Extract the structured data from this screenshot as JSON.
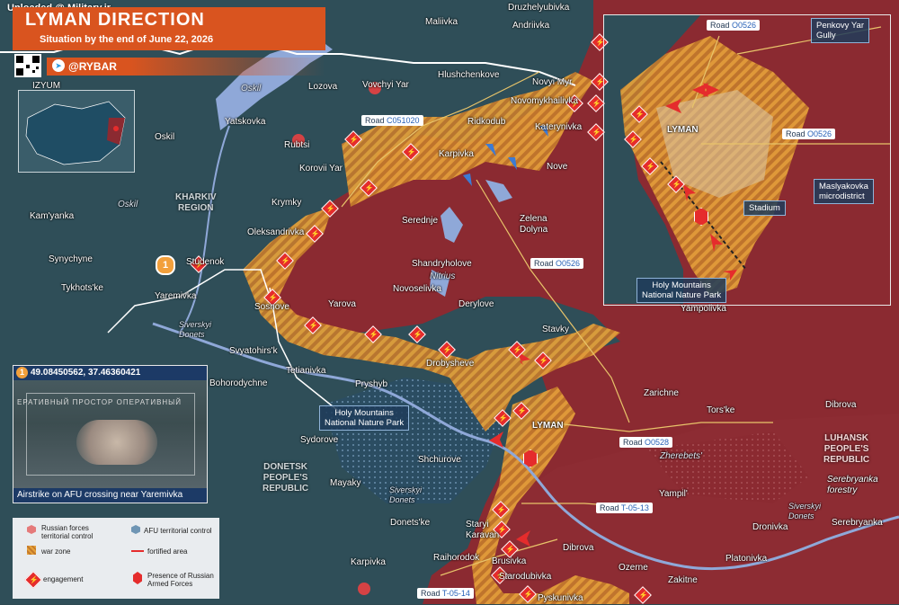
{
  "header": {
    "watermark": "Uploaded @ Military.ir",
    "title": "LYMAN DIRECTION",
    "subtitle": "Situation by the end of June 22, 2026",
    "brand": "@RYBAR"
  },
  "regions": {
    "kharkiv": "KHARKIV\nREGION",
    "donetsk": "DONETSK\nPEOPLE'S\nREPUBLIC",
    "luhansk": "LUHANSK\nPEOPLE'S\nREPUBLIC"
  },
  "places": [
    {
      "name": "Maliivka"
    },
    {
      "name": "Druzhelyubivka"
    },
    {
      "name": "Andriivka"
    },
    {
      "name": "Hlushchenkove"
    },
    {
      "name": "Lozova"
    },
    {
      "name": "Vovchyi Yar"
    },
    {
      "name": "Novyi Myr"
    },
    {
      "name": "Novomykhailivka"
    },
    {
      "name": "Ridkodub"
    },
    {
      "name": "Katerynivka"
    },
    {
      "name": "Yatskovka"
    },
    {
      "name": "Rubtsi"
    },
    {
      "name": "Oskil"
    },
    {
      "name": "Karpivka"
    },
    {
      "name": "Nove"
    },
    {
      "name": "Korovii Yar"
    },
    {
      "name": "Krymky"
    },
    {
      "name": "Serednje"
    },
    {
      "name": "Zelena\nDolyna"
    },
    {
      "name": "Kam'yanka"
    },
    {
      "name": "Oleksandrivka"
    },
    {
      "name": "Synychyne"
    },
    {
      "name": "Studenok"
    },
    {
      "name": "Shandryholove"
    },
    {
      "name": "Tykhots'ke"
    },
    {
      "name": "Yaremivka"
    },
    {
      "name": "Novoselivka"
    },
    {
      "name": "Derylove"
    },
    {
      "name": "Sosnove"
    },
    {
      "name": "Yarova"
    },
    {
      "name": "Yampolivka"
    },
    {
      "name": "Stavky"
    },
    {
      "name": "Svyatohirs'k"
    },
    {
      "name": "Drobysheve"
    },
    {
      "name": "Tetianivka"
    },
    {
      "name": "Pryshyb"
    },
    {
      "name": "Bohorodychne"
    },
    {
      "name": "Zarichne"
    },
    {
      "name": "Dibrova"
    },
    {
      "name": "LYMAN"
    },
    {
      "name": "Tors'ke"
    },
    {
      "name": "Sydorove"
    },
    {
      "name": "Shchurove"
    },
    {
      "name": "Mayaky"
    },
    {
      "name": "Yampil'"
    },
    {
      "name": "Donets'ke"
    },
    {
      "name": "Staryi\nKaravan"
    },
    {
      "name": "Dibrova"
    },
    {
      "name": "Dronivka"
    },
    {
      "name": "Serebryanka"
    },
    {
      "name": "Karpivka"
    },
    {
      "name": "Raihorodok"
    },
    {
      "name": "Brusivka"
    },
    {
      "name": "Ozerne"
    },
    {
      "name": "Platonivka"
    },
    {
      "name": "Starodubivka"
    },
    {
      "name": "Zakitne"
    },
    {
      "name": "Pyskunivka"
    },
    {
      "name": "IZYUM"
    },
    {
      "name": "Serebryanka\nforestry"
    }
  ],
  "water": [
    {
      "name": "Oskil"
    },
    {
      "name": "Oskil"
    },
    {
      "name": "Nitrius"
    },
    {
      "name": "Siverskyi\nDonets"
    },
    {
      "name": "Zherebets'"
    },
    {
      "name": "Siverskyi\nDonets"
    },
    {
      "name": "Siverskyi\nDonets"
    }
  ],
  "roads": [
    {
      "prefix": "Road ",
      "code": "C051020"
    },
    {
      "prefix": "Road ",
      "code": "O0526"
    },
    {
      "prefix": "Road ",
      "code": "O0528"
    },
    {
      "prefix": "Road ",
      "code": "T-05-13"
    },
    {
      "prefix": "Road ",
      "code": "T-05-14"
    }
  ],
  "parks": {
    "main": "Holy Mountains\nNational Nature Park"
  },
  "inset": {
    "road_top": {
      "prefix": "Road ",
      "code": "O0526"
    },
    "road_right": {
      "prefix": "Road ",
      "code": "O0526"
    },
    "gully": "Penkovy Yar\nGully",
    "city": "LYMAN",
    "microdistrict": "Maslyakovka\nmicrodistrict",
    "stadium": "Stadium",
    "park": "Holy Mountains\nNational Nature Park"
  },
  "photo": {
    "badge": "1",
    "coords": "49.08450562, 37.46360421",
    "caption": "Airstrike on AFU crossing near Yaremivka",
    "overlay": "ЕРАТИВНЫЙ ПРОСТОР ОПЕРАТИВНЫЙ"
  },
  "marker_badge": "1",
  "legend": {
    "ru": "Russian forces\nterritorial control",
    "afu": "AFU territorial control",
    "war": "war zone",
    "fort": "fortified area",
    "eng": "engagement",
    "presence": "Presence of Russian\nArmed Forces"
  },
  "colors": {
    "russian": "#8b2a31",
    "afu": "#2f4e58",
    "warzone": "#e0a030",
    "accent": "#d9541f",
    "water": "#8fa8d8"
  }
}
